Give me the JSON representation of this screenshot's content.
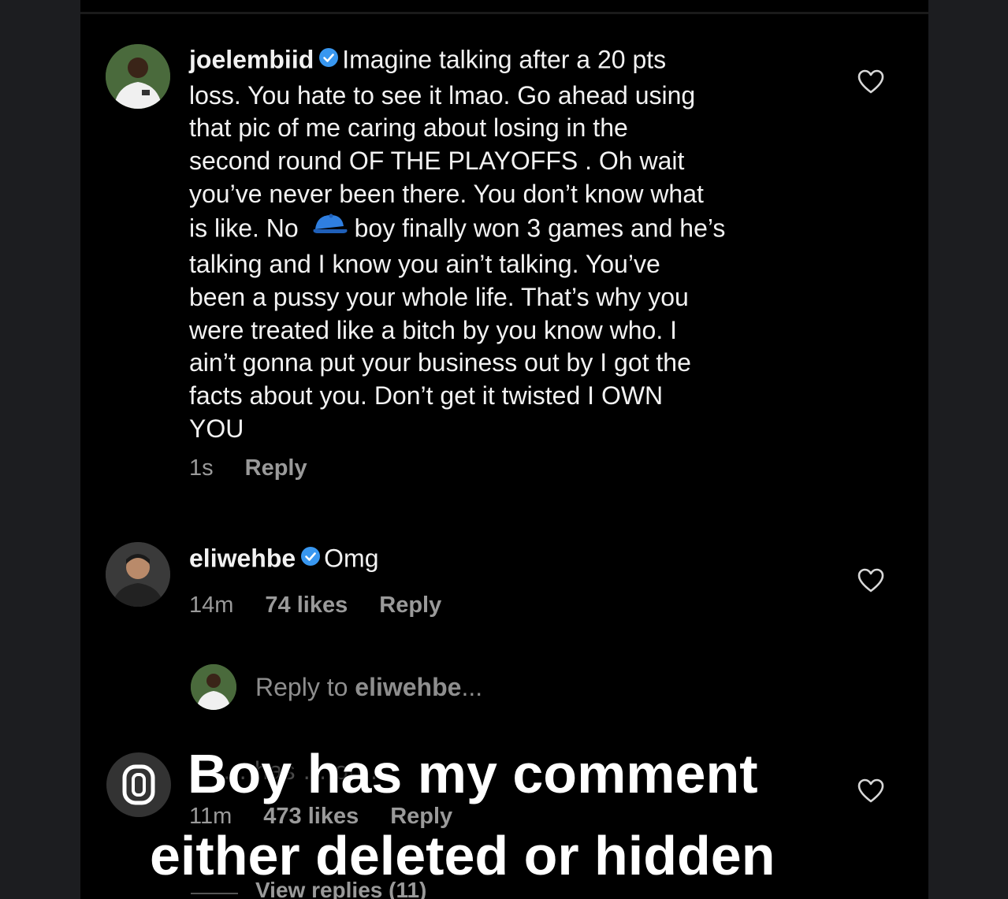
{
  "comments": [
    {
      "username": "joelembiid",
      "verified": true,
      "lines": [
        "Imagine talking after a 20 pts",
        "loss. You hate to see it lmao. Go ahead using",
        "that pic of me caring about losing in the",
        "second round OF THE PLAYOFFS . Oh wait",
        "you’ve never been there. You don’t know what",
        "is like. No",
        "boy finally won 3 games and he’s",
        "talking and I know you ain’t talking. You’ve",
        "been a pussy your whole life. That’s why you",
        "were treated like a bitch by you know who. I",
        "ain’t gonna put your business out by I got the",
        "facts about you. Don’t get it twisted I OWN",
        "YOU"
      ],
      "emoji": "blue-cap-emoji",
      "time": "1s",
      "reply_label": "Reply"
    },
    {
      "username": "eliwehbe",
      "verified": true,
      "text": "Omg",
      "time": "14m",
      "likes": "74 likes",
      "reply_label": "Reply"
    },
    {
      "ghost_text": "… has … on …",
      "time": "11m",
      "likes": "473 likes",
      "reply_label": "Reply"
    }
  ],
  "reply_input": {
    "prefix": "Reply to ",
    "username": "eliwehbe",
    "suffix": "..."
  },
  "view_replies": "View replies (11)",
  "overlay_caption": {
    "line1": "Boy has my comment",
    "line2": "either deleted or hidden"
  },
  "icons": {
    "heart": "heart-outline-icon",
    "verified": "verified-badge-icon",
    "sticker": "zero-badge-icon"
  },
  "colors": {
    "background": "#000000",
    "verified": "#3897f0",
    "meta": "#9a9a9a"
  }
}
